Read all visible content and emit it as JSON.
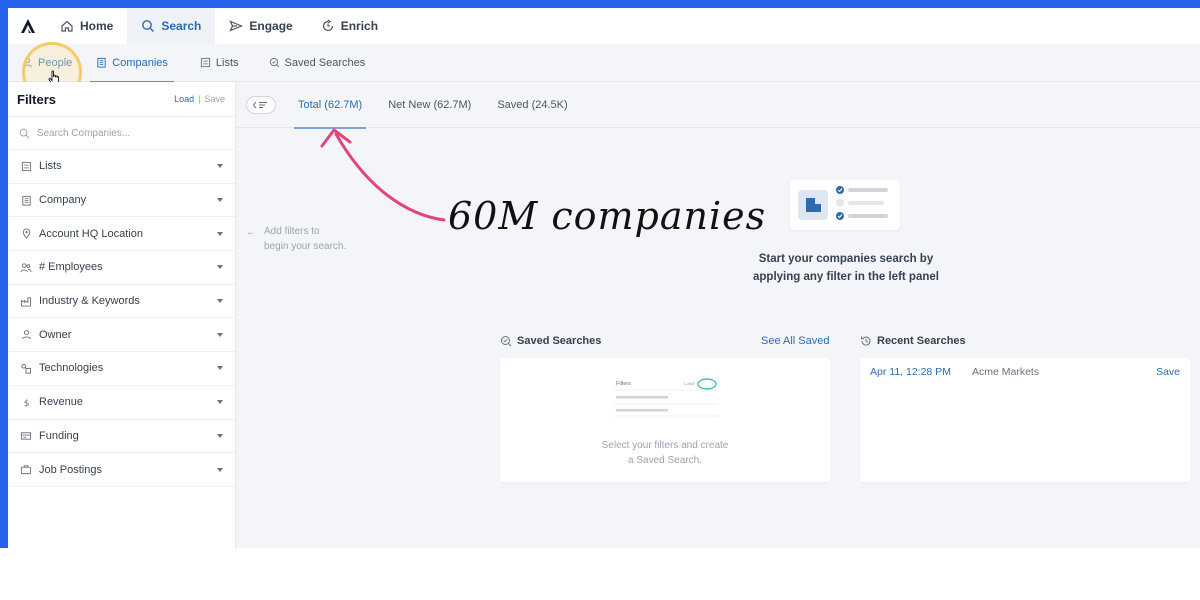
{
  "top_nav": {
    "items": [
      {
        "label": "Home",
        "icon": "home-icon",
        "active": false
      },
      {
        "label": "Search",
        "icon": "search-icon",
        "active": true
      },
      {
        "label": "Engage",
        "icon": "send-icon",
        "active": false
      },
      {
        "label": "Enrich",
        "icon": "refresh-icon",
        "active": false
      }
    ]
  },
  "sub_nav": {
    "items": [
      {
        "label": "People",
        "icon": "person-icon"
      },
      {
        "label": "Companies",
        "icon": "building-icon",
        "active": true
      },
      {
        "label": "Lists",
        "icon": "list-icon"
      },
      {
        "label": "Saved Searches",
        "icon": "saved-search-icon"
      }
    ]
  },
  "sidebar": {
    "title": "Filters",
    "load_label": "Load",
    "separator": "|",
    "save_label": "Save",
    "search_placeholder": "Search Companies...",
    "filters": [
      {
        "label": "Lists",
        "icon": "list-icon"
      },
      {
        "label": "Company",
        "icon": "building-icon"
      },
      {
        "label": "Account HQ Location",
        "icon": "location-pin-icon"
      },
      {
        "label": "# Employees",
        "icon": "people-icon"
      },
      {
        "label": "Industry & Keywords",
        "icon": "industry-icon"
      },
      {
        "label": "Owner",
        "icon": "person-icon"
      },
      {
        "label": "Technologies",
        "icon": "technologies-icon"
      },
      {
        "label": "Revenue",
        "icon": "dollar-icon"
      },
      {
        "label": "Funding",
        "icon": "funding-icon"
      },
      {
        "label": "Job Postings",
        "icon": "briefcase-icon"
      }
    ]
  },
  "main": {
    "tabs": [
      {
        "label": "Total (62.7M)",
        "active": true
      },
      {
        "label": "Net New (62.7M)",
        "active": false
      },
      {
        "label": "Saved (24.5K)",
        "active": false
      }
    ],
    "hint_line1": "Add filters to",
    "hint_line2": "begin your search.",
    "empty_line1": "Start your companies search by",
    "empty_line2": "applying any filter in the left panel",
    "saved_searches": {
      "title": "Saved Searches",
      "see_all": "See All Saved",
      "illustration_filters": "Filters",
      "illustration_load": "Load",
      "empty_line1": "Select your filters and create",
      "empty_line2": "a Saved Search."
    },
    "recent_searches": {
      "title": "Recent Searches",
      "rows": [
        {
          "date": "Apr 11, 12:28 PM",
          "name": "Acme Markets",
          "action": "Save"
        }
      ]
    }
  },
  "annotation": {
    "text": "60M companies"
  },
  "colors": {
    "frame_blue": "#2563eb",
    "accent_blue": "#2b6cb0",
    "annotation_arrow": "#e0457b",
    "highlight_ring": "#f6c96a"
  }
}
